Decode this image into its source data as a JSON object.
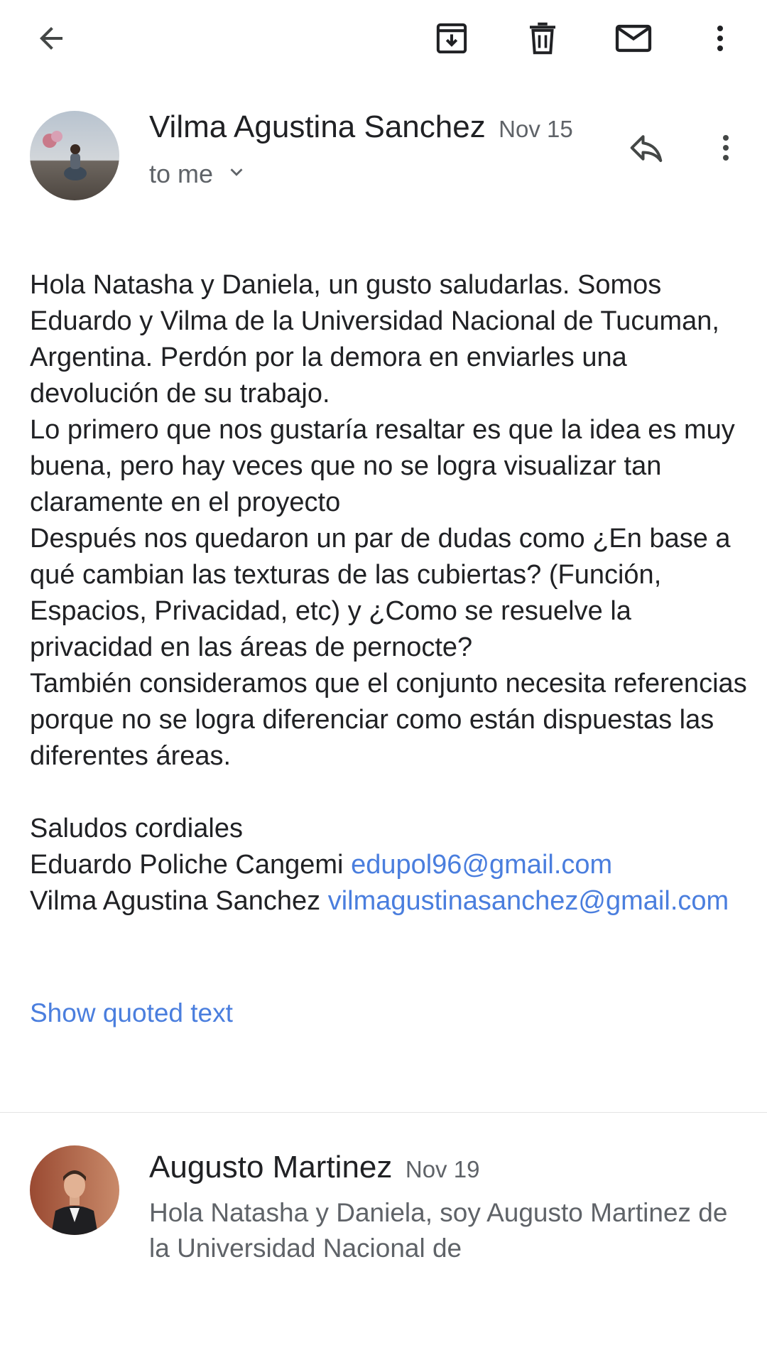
{
  "toolbar": {
    "back_icon": "arrow-back-icon",
    "archive_icon": "archive-icon",
    "delete_icon": "trash-icon",
    "mark_unread_icon": "mail-icon",
    "more_icon": "more-vert-icon"
  },
  "message": {
    "sender": "Vilma Agustina Sanchez",
    "date": "Nov 15",
    "recipient": "to me",
    "body": {
      "paragraph1": "Hola Natasha y Daniela, un gusto saludarlas. Somos Eduardo y Vilma de la Universidad Nacional de Tucuman, Argentina. Perdón por la demora en enviarles una devolución de su trabajo.",
      "paragraph2": "Lo primero que nos gustaría resaltar es que la idea es muy buena, pero hay veces que no se logra visualizar tan claramente en el proyecto",
      "paragraph3": "Después nos quedaron un par de dudas como ¿En base a qué cambian las texturas de las cubiertas? (Función, Espacios, Privacidad, etc) y ¿Como se resuelve la privacidad en las áreas de pernocte?",
      "paragraph4": "También consideramos que el conjunto necesita referencias porque no se logra diferenciar como están dispuestas las diferentes áreas.",
      "closing": "Saludos cordiales",
      "signature1_name": "Eduardo Poliche Cangemi",
      "signature1_email": "edupol96@gmail.com",
      "signature2_name": "Vilma Agustina Sanchez",
      "signature2_email": "vilmagustinasanchez@gmail.com"
    },
    "show_quoted": "Show quoted text"
  },
  "next_message": {
    "sender": "Augusto Martinez",
    "date": "Nov 19",
    "snippet": "Hola Natasha y Daniela, soy Augusto Martinez de la Universidad Nacional de"
  },
  "colors": {
    "link": "#4a7ede",
    "secondary_text": "#5f6368",
    "primary_text": "#202124"
  }
}
